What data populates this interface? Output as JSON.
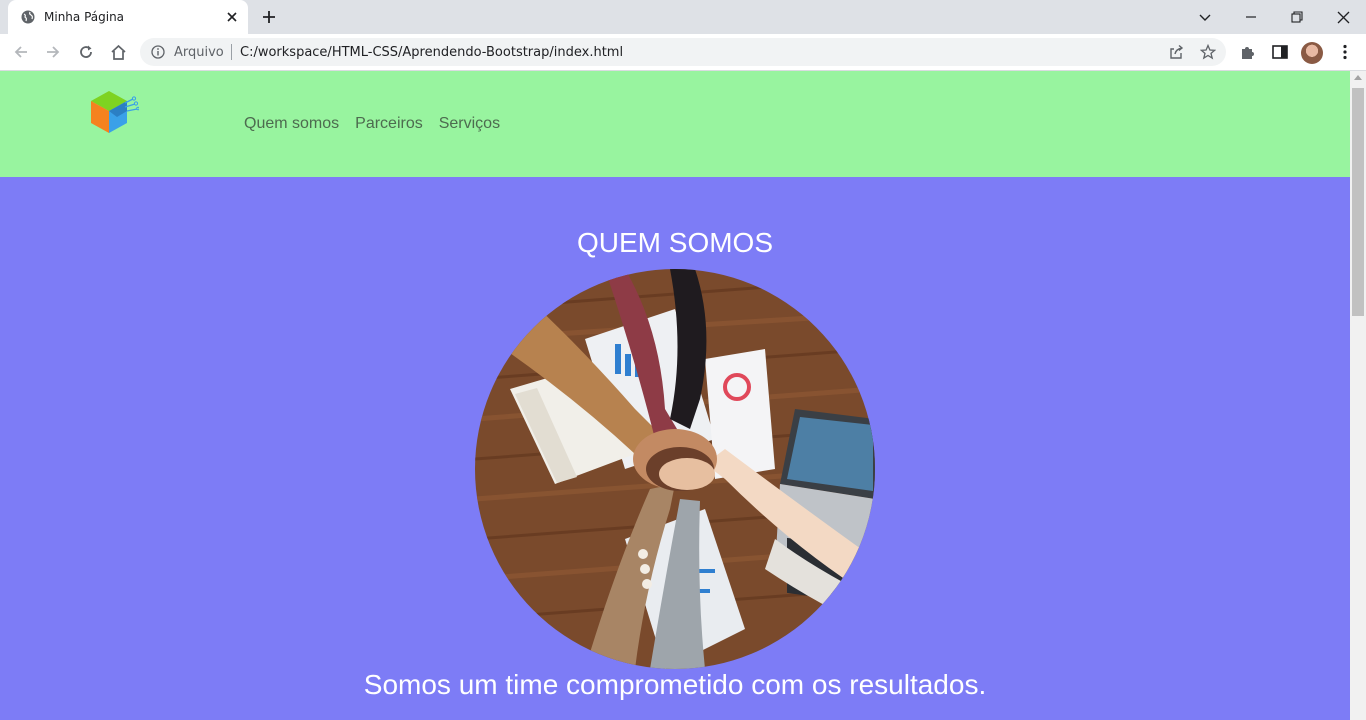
{
  "browser": {
    "tab_title": "Minha Página",
    "omnibox_label": "Arquivo",
    "url": "C:/workspace/HTML-CSS/Aprendendo-Bootstrap/index.html"
  },
  "site": {
    "nav": [
      "Quem somos",
      "Parceiros",
      "Serviços"
    ],
    "hero_title": "QUEM SOMOS",
    "hero_text": "Somos um time comprometido com os resultados."
  },
  "colors": {
    "header_bg": "#98f49f",
    "hero_bg": "#7d7cf6",
    "nav_text": "#4d6b4f"
  }
}
